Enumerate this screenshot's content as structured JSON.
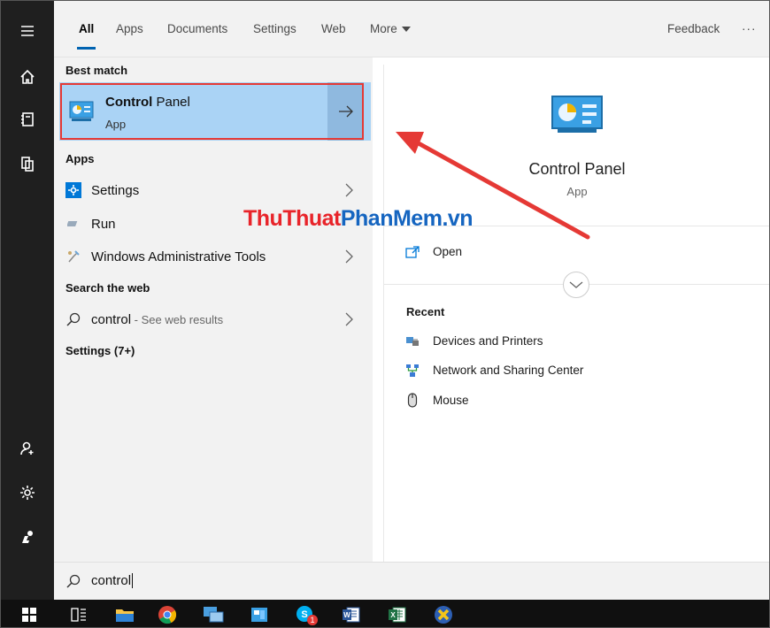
{
  "tabs": [
    "All",
    "Apps",
    "Documents",
    "Settings",
    "Web",
    "More"
  ],
  "feedback_label": "Feedback",
  "ellipsis_label": "···",
  "best_match": {
    "heading": "Best match",
    "title_bold": "Control",
    "title_rest": " Panel",
    "subtitle": "App"
  },
  "apps": {
    "heading": "Apps",
    "items": [
      {
        "label": "Settings",
        "icon": "settings-gear-icon"
      },
      {
        "label": "Run",
        "icon": "run-icon"
      },
      {
        "label": "Windows Administrative Tools",
        "icon": "admin-tools-icon"
      }
    ]
  },
  "web": {
    "heading": "Search the web",
    "query": "control",
    "suffix": " - See web results"
  },
  "settings_more": "Settings (7+)",
  "preview": {
    "title": "Control Panel",
    "subtitle": "App",
    "open_label": "Open",
    "recent_heading": "Recent",
    "recent": [
      {
        "label": "Devices and Printers",
        "icon": "devices-printers-icon"
      },
      {
        "label": "Network and Sharing Center",
        "icon": "network-sharing-icon"
      },
      {
        "label": "Mouse",
        "icon": "mouse-icon"
      }
    ]
  },
  "search": {
    "value": "control"
  },
  "watermark": {
    "part1": "ThuThuat",
    "part2": "PhanMem.vn"
  },
  "taskbar_badge": "1",
  "colors": {
    "accent": "#0063b1",
    "selection": "#aad3f5",
    "highlight_outline": "#e53935",
    "annotation_arrow": "#e53935"
  }
}
